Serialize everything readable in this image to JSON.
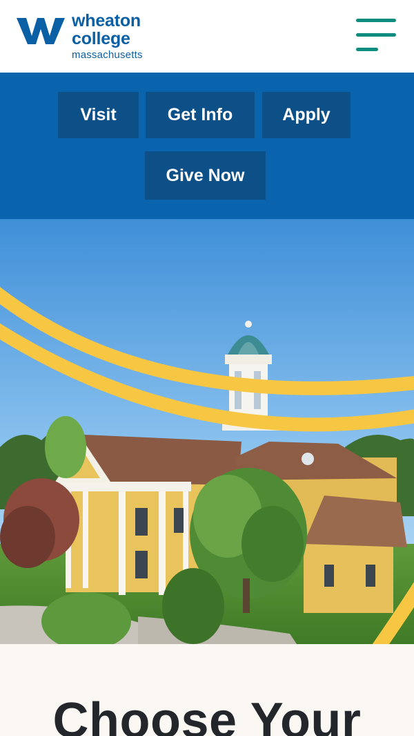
{
  "brand": {
    "name_line1": "wheaton",
    "name_line2": "college",
    "name_line3": "massachusetts",
    "logo_letter": "W",
    "primary_color": "#0a63ad",
    "accent_color": "#0e8c80",
    "arc_color": "#f7c744"
  },
  "header": {
    "menu_icon": "hamburger-menu-icon"
  },
  "actions": {
    "visit_label": "Visit",
    "get_info_label": "Get Info",
    "apply_label": "Apply",
    "give_now_label": "Give Now"
  },
  "hero": {
    "image_subject": "campus-building-with-cupola"
  },
  "section": {
    "heading": "Choose Your"
  }
}
